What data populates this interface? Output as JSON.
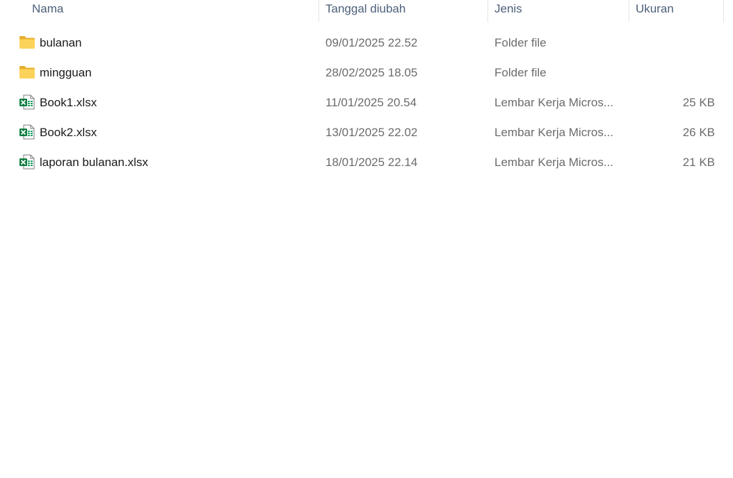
{
  "columns": {
    "name": "Nama",
    "date": "Tanggal diubah",
    "type": "Jenis",
    "size": "Ukuran"
  },
  "files": [
    {
      "name": "bulanan",
      "date": "09/01/2025 22.52",
      "type": "Folder file",
      "size": "",
      "icon": "folder-icon"
    },
    {
      "name": "mingguan",
      "date": "28/02/2025 18.05",
      "type": "Folder file",
      "size": "",
      "icon": "folder-icon"
    },
    {
      "name": "Book1.xlsx",
      "date": "11/01/2025 20.54",
      "type": "Lembar Kerja Micros...",
      "size": "25 KB",
      "icon": "excel-file-icon"
    },
    {
      "name": "Book2.xlsx",
      "date": "13/01/2025 22.02",
      "type": "Lembar Kerja Micros...",
      "size": "26 KB",
      "icon": "excel-file-icon"
    },
    {
      "name": "laporan bulanan.xlsx",
      "date": "18/01/2025 22.14",
      "type": "Lembar Kerja Micros...",
      "size": "21 KB",
      "icon": "excel-file-icon"
    }
  ],
  "colors": {
    "header_text": "#4c607a",
    "folder": "#f8c743",
    "excel_green": "#107c41"
  }
}
